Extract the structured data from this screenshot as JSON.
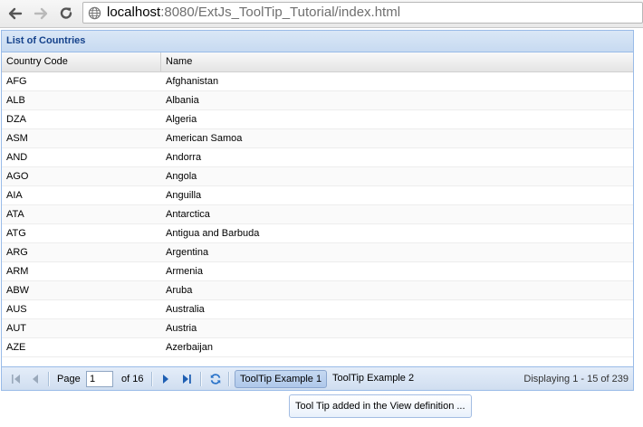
{
  "browser": {
    "url_host": "localhost",
    "url_rest": ":8080/ExtJs_ToolTip_Tutorial/index.html"
  },
  "panel": {
    "title": "List of Countries"
  },
  "grid": {
    "columns": [
      "Country Code",
      "Name"
    ],
    "rows": [
      [
        "AFG",
        "Afghanistan"
      ],
      [
        "ALB",
        "Albania"
      ],
      [
        "DZA",
        "Algeria"
      ],
      [
        "ASM",
        "American Samoa"
      ],
      [
        "AND",
        "Andorra"
      ],
      [
        "AGO",
        "Angola"
      ],
      [
        "AIA",
        "Anguilla"
      ],
      [
        "ATA",
        "Antarctica"
      ],
      [
        "ATG",
        "Antigua and Barbuda"
      ],
      [
        "ARG",
        "Argentina"
      ],
      [
        "ARM",
        "Armenia"
      ],
      [
        "ABW",
        "Aruba"
      ],
      [
        "AUS",
        "Australia"
      ],
      [
        "AUT",
        "Austria"
      ],
      [
        "AZE",
        "Azerbaijan"
      ]
    ]
  },
  "paging": {
    "page_label": "Page",
    "page_value": "1",
    "of_label": "of 16",
    "button1": "ToolTip Example 1",
    "button2": "ToolTip Example 2",
    "displaying": "Displaying 1 - 15 of 239"
  },
  "tooltip": {
    "text": "Tool Tip added in the View definition ..."
  },
  "colors": {
    "panel_border": "#99bbe8",
    "title_color": "#15428b",
    "nav_blue": "#1f5fb3"
  }
}
